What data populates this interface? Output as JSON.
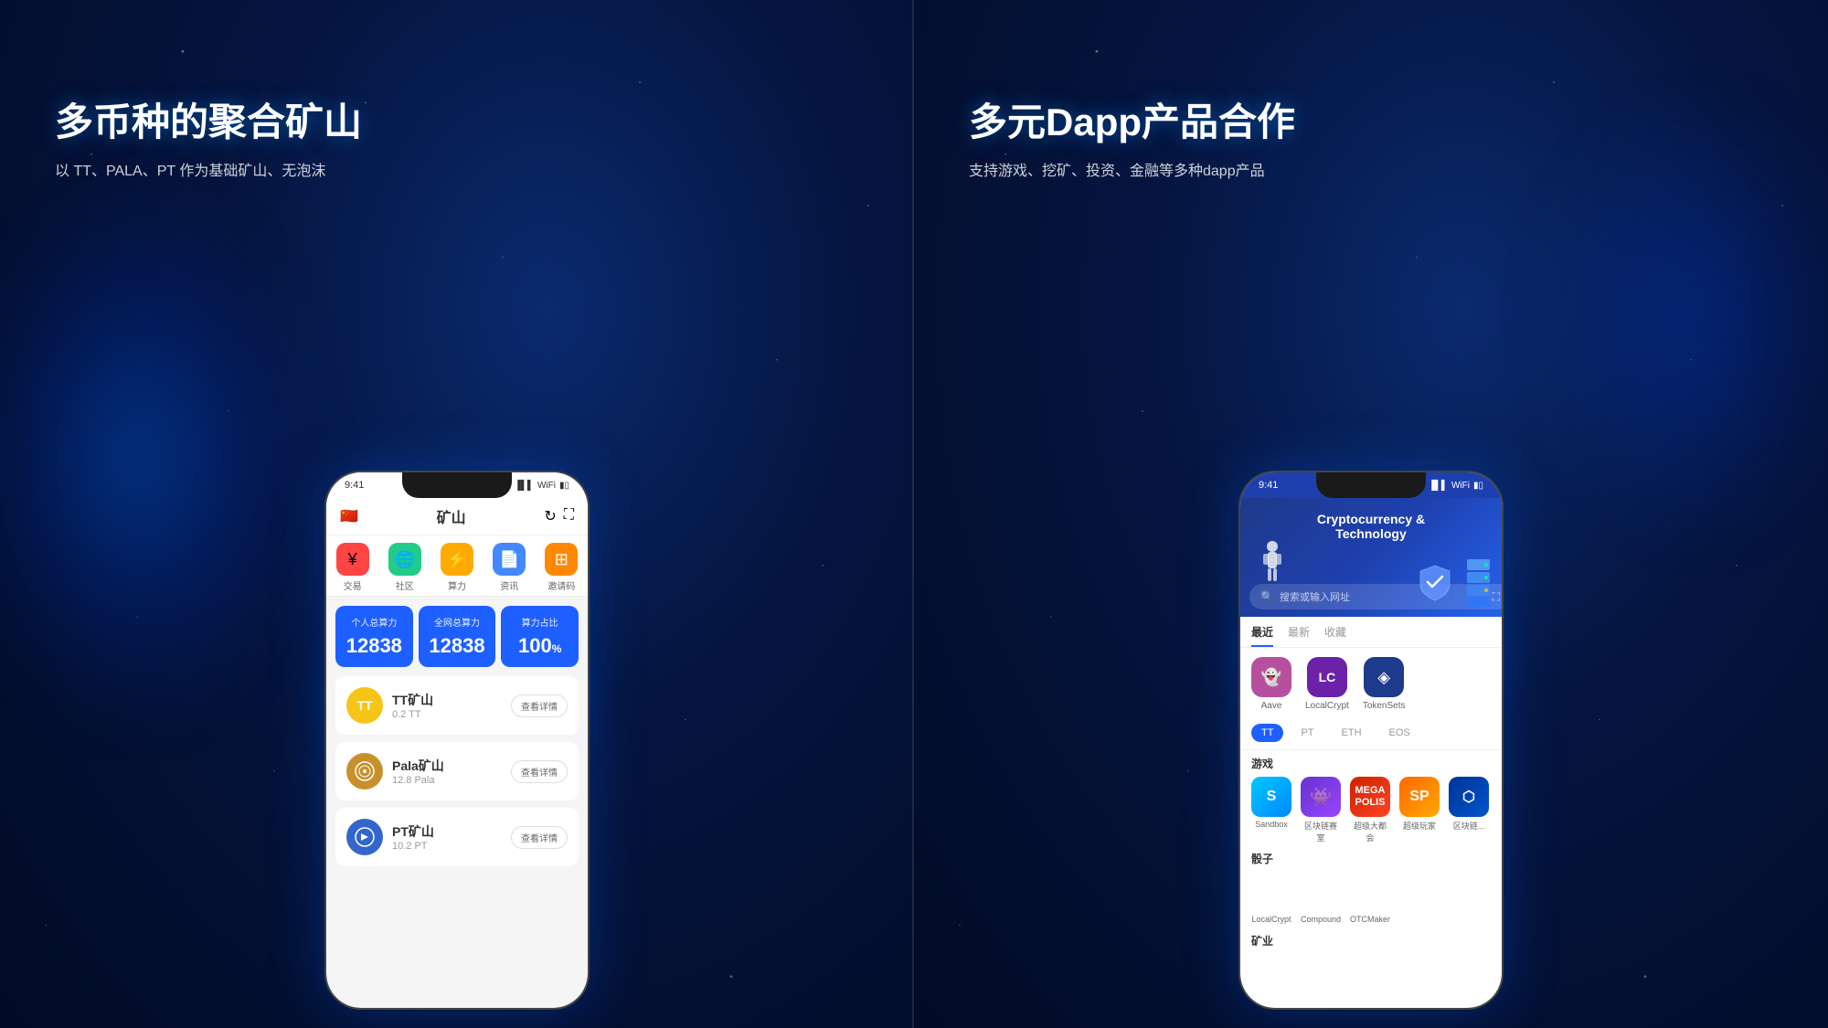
{
  "left_panel": {
    "title": "多币种的聚合矿山",
    "subtitle": "以 TT、PALA、PT 作为基础矿山、无泡沫",
    "phone": {
      "status_bar": {
        "time": "9:41",
        "signal": "signal",
        "wifi": "wifi",
        "battery": "battery"
      },
      "header": {
        "flag": "🇨🇳",
        "title": "矿山",
        "refresh_icon": "refresh",
        "fullscreen_icon": "fullscreen"
      },
      "nav_items": [
        {
          "label": "交易",
          "icon": "¥",
          "color": "red"
        },
        {
          "label": "社区",
          "icon": "🌐",
          "color": "green"
        },
        {
          "label": "算力",
          "icon": "⚡",
          "color": "yellow"
        },
        {
          "label": "资讯",
          "icon": "📄",
          "color": "blue-light"
        },
        {
          "label": "邀请码",
          "icon": "🔲",
          "color": "orange"
        }
      ],
      "stats": [
        {
          "label": "个人总算力",
          "value": "12838"
        },
        {
          "label": "全网总算力",
          "value": "12838"
        },
        {
          "label": "算力占比",
          "value": "100",
          "unit": "%"
        }
      ],
      "mining_items": [
        {
          "name": "TT矿山",
          "amount": "0.2 TT",
          "icon_color": "tt",
          "button": "查看详情"
        },
        {
          "name": "Pala矿山",
          "amount": "12.8 Pala",
          "icon_color": "pala",
          "button": "查看详情"
        },
        {
          "name": "PT矿山",
          "amount": "10.2 PT",
          "icon_color": "pt",
          "button": "查看详情"
        }
      ]
    }
  },
  "right_panel": {
    "title": "多元Dapp产品合作",
    "subtitle": "支持游戏、挖矿、投资、金融等多种dapp产品",
    "phone": {
      "status_bar": {
        "time": "9:41",
        "signal": "signal",
        "wifi": "wifi",
        "battery": "battery"
      },
      "hero": {
        "title_line1": "Cryptocurrency &",
        "title_line2": "Technology"
      },
      "search_placeholder": "搜索或输入网址",
      "tabs": [
        {
          "label": "最近",
          "active": true
        },
        {
          "label": "最新",
          "active": false
        },
        {
          "label": "收藏",
          "active": false
        }
      ],
      "recent_apps": [
        {
          "name": "Aave",
          "icon_color": "aave"
        },
        {
          "name": "LocalCrypt",
          "icon_color": "localcrypt"
        },
        {
          "name": "TokenSets",
          "icon_color": "tokensets"
        }
      ],
      "chain_tabs": [
        {
          "label": "TT",
          "active": true
        },
        {
          "label": "PT",
          "active": false
        },
        {
          "label": "ETH",
          "active": false
        },
        {
          "label": "EOS",
          "active": false
        }
      ],
      "game_section": {
        "title": "游戏",
        "apps": [
          {
            "name": "Sandbox",
            "color": "sandbox"
          },
          {
            "name": "区块链赛室",
            "color": "blockchain"
          },
          {
            "name": "超级大都会",
            "color": "megapolis"
          },
          {
            "name": "超级玩家",
            "color": "superpolis"
          },
          {
            "name": "区块链...",
            "color": "defi"
          }
        ]
      },
      "dice_section": {
        "title": "骰子",
        "apps": [
          {
            "name": "LocalCrypt",
            "color": "localcrypt2"
          },
          {
            "name": "Compound",
            "color": "compound"
          },
          {
            "name": "OTCMaker",
            "color": "otcmaker"
          }
        ]
      },
      "mining_section": {
        "title": "矿业"
      }
    }
  }
}
